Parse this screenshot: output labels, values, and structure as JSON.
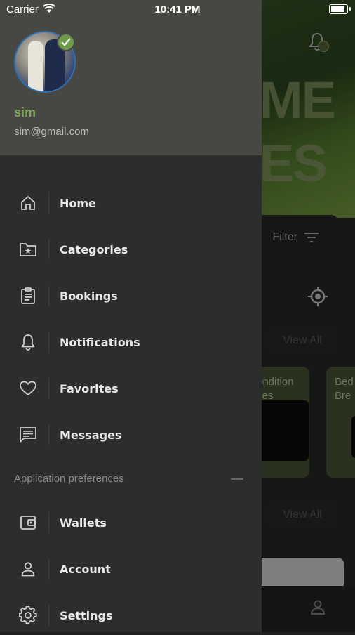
{
  "status_bar": {
    "carrier": "Carrier",
    "time": "10:41 PM"
  },
  "user": {
    "name": "sim",
    "email": "sim@gmail.com"
  },
  "menu": [
    {
      "label": "Home",
      "icon": "home-icon"
    },
    {
      "label": "Categories",
      "icon": "folder-star-icon"
    },
    {
      "label": "Bookings",
      "icon": "clipboard-icon"
    },
    {
      "label": "Notifications",
      "icon": "bell-icon"
    },
    {
      "label": "Favorites",
      "icon": "heart-icon"
    },
    {
      "label": "Messages",
      "icon": "message-icon"
    }
  ],
  "preferences": {
    "section_title": "Application preferences",
    "items": [
      {
        "label": "Wallets",
        "icon": "wallet-icon"
      },
      {
        "label": "Account",
        "icon": "person-icon"
      },
      {
        "label": "Settings",
        "icon": "gear-icon"
      }
    ]
  },
  "background": {
    "hero_words": [
      "ME",
      "ES"
    ],
    "filter_label": "Filter",
    "view_all_label": "View All",
    "cards": [
      {
        "title": "ondition\nces"
      },
      {
        "title": "Bed\nBre"
      }
    ]
  },
  "colors": {
    "accent": "#7fa65a",
    "drawer_bg": "#2d2d2d",
    "header_bg": "#474843"
  }
}
